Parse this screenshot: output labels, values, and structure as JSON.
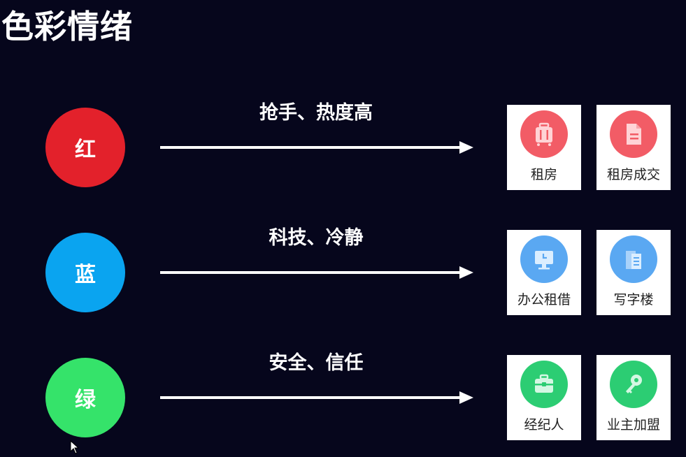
{
  "title": "色彩情绪",
  "rows": [
    {
      "color_word": "红",
      "color": "#e3212b",
      "meaning": "抢手、热度高",
      "cards": [
        {
          "label": "租房",
          "icon": "suitcase-icon",
          "icon_color": "#f25c66"
        },
        {
          "label": "租房成交",
          "icon": "document-icon",
          "icon_color": "#f25c66"
        }
      ]
    },
    {
      "color_word": "蓝",
      "color": "#0aa4f0",
      "meaning": "科技、冷静",
      "cards": [
        {
          "label": "办公租借",
          "icon": "monitor-clock-icon",
          "icon_color": "#5aa8f2"
        },
        {
          "label": "写字楼",
          "icon": "building-icon",
          "icon_color": "#5aa8f2"
        }
      ]
    },
    {
      "color_word": "绿",
      "color": "#35e36a",
      "meaning": "安全、信任",
      "cards": [
        {
          "label": "经纪人",
          "icon": "briefcase-icon",
          "icon_color": "#2ccd73"
        },
        {
          "label": "业主加盟",
          "icon": "key-icon",
          "icon_color": "#2ccd73"
        }
      ]
    }
  ]
}
